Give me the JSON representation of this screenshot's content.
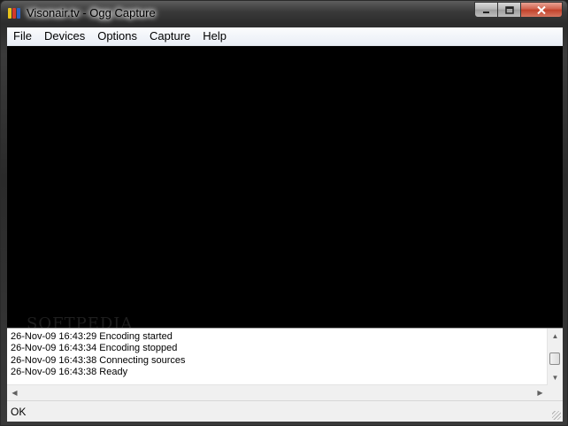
{
  "window": {
    "title": "Visonair.tv - Ogg Capture",
    "icon": "app-icon",
    "buttons": {
      "minimize": "minimize-icon",
      "maximize": "maximize-icon",
      "close": "close-icon"
    }
  },
  "menu": {
    "items": [
      {
        "label": "File"
      },
      {
        "label": "Devices"
      },
      {
        "label": "Options"
      },
      {
        "label": "Capture"
      },
      {
        "label": "Help"
      }
    ]
  },
  "watermark": "SOFTPEDIA",
  "log": {
    "lines": [
      "26-Nov-09 16:43:29 Encoding started",
      "26-Nov-09 16:43:34 Encoding stopped",
      "26-Nov-09 16:43:38 Connecting sources",
      "26-Nov-09 16:43:38 Ready"
    ]
  },
  "status": {
    "text": "OK"
  },
  "colors": {
    "video_background": "#000000",
    "client_background": "#f0f0f0"
  }
}
